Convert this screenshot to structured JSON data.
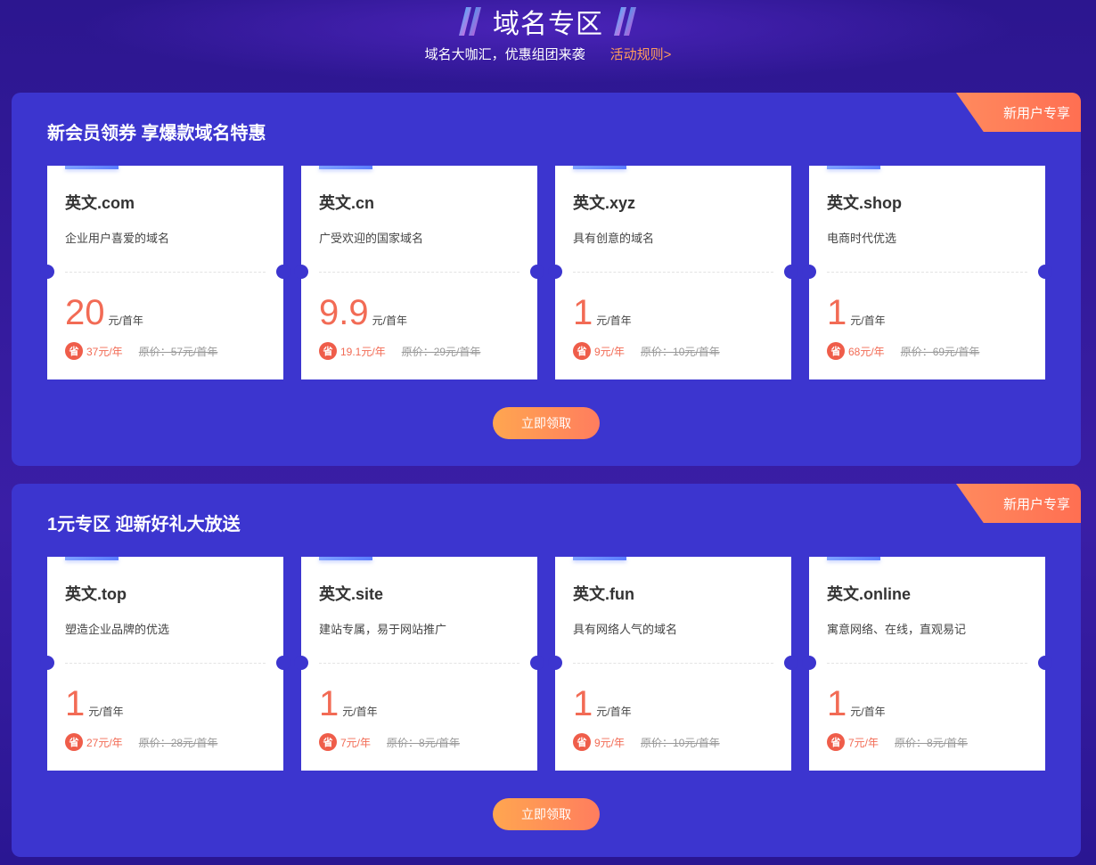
{
  "header": {
    "title": "域名专区",
    "slogan": "域名大咖汇，优惠组团来袭",
    "rules_link": "活动规则>"
  },
  "colors": {
    "background": "#2c168f",
    "panel": "#3c35cf",
    "accent_orange": "#ff7d5e",
    "price_red": "#f26b55"
  },
  "sections": [
    {
      "title": "新会员领券 享爆款域名特惠",
      "badge": "新用户专享",
      "button": "立即领取",
      "cards": [
        {
          "name": "英文.com",
          "desc": "企业用户喜爱的域名",
          "price": "20",
          "unit": "元/首年",
          "save_icon": "省",
          "save": "37元/年",
          "original": "原价：57元/首年"
        },
        {
          "name": "英文.cn",
          "desc": "广受欢迎的国家域名",
          "price": "9.9",
          "unit": "元/首年",
          "save_icon": "省",
          "save": "19.1元/年",
          "original": "原价：29元/首年"
        },
        {
          "name": "英文.xyz",
          "desc": "具有创意的域名",
          "price": "1",
          "unit": "元/首年",
          "save_icon": "省",
          "save": "9元/年",
          "original": "原价：10元/首年"
        },
        {
          "name": "英文.shop",
          "desc": "电商时代优选",
          "price": "1",
          "unit": "元/首年",
          "save_icon": "省",
          "save": "68元/年",
          "original": "原价：69元/首年"
        }
      ]
    },
    {
      "title": "1元专区 迎新好礼大放送",
      "badge": "新用户专享",
      "button": "立即领取",
      "cards": [
        {
          "name": "英文.top",
          "desc": "塑造企业品牌的优选",
          "price": "1",
          "unit": "元/首年",
          "save_icon": "省",
          "save": "27元/年",
          "original": "原价：28元/首年"
        },
        {
          "name": "英文.site",
          "desc": "建站专属，易于网站推广",
          "price": "1",
          "unit": "元/首年",
          "save_icon": "省",
          "save": "7元/年",
          "original": "原价：8元/首年"
        },
        {
          "name": "英文.fun",
          "desc": "具有网络人气的域名",
          "price": "1",
          "unit": "元/首年",
          "save_icon": "省",
          "save": "9元/年",
          "original": "原价：10元/首年"
        },
        {
          "name": "英文.online",
          "desc": "寓意网络、在线，直观易记",
          "price": "1",
          "unit": "元/首年",
          "save_icon": "省",
          "save": "7元/年",
          "original": "原价：8元/首年"
        }
      ]
    }
  ]
}
